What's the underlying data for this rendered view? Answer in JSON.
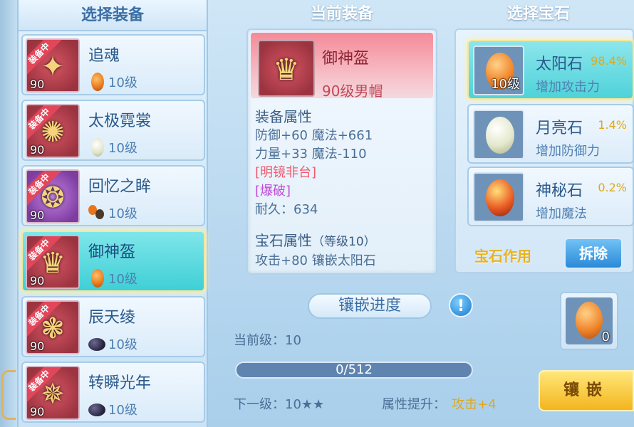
{
  "titles": {
    "select_equipment": "选择装备",
    "current_equipment": "当前装备",
    "select_gem": "选择宝石"
  },
  "equipment_list": [
    {
      "badge": "装备中",
      "level": "90",
      "name": "追魂",
      "gem_type": "orange",
      "gem_level": "10级",
      "glyph": "✦"
    },
    {
      "badge": "装备中",
      "level": "90",
      "name": "太极霓裳",
      "gem_type": "white",
      "gem_level": "10级",
      "glyph": "✺"
    },
    {
      "badge": "装备中",
      "level": "90",
      "name": "回忆之眸",
      "gem_type": "mixed",
      "gem_level": "10级",
      "glyph": "❂"
    },
    {
      "badge": "装备中",
      "level": "90",
      "name": "御神盔",
      "gem_type": "orange",
      "gem_level": "10级",
      "glyph": "♛",
      "selected": true
    },
    {
      "badge": "装备中",
      "level": "90",
      "name": "辰天绫",
      "gem_type": "dark",
      "gem_level": "10级",
      "glyph": "❃"
    },
    {
      "badge": "装备中",
      "level": "90",
      "name": "转瞬光年",
      "gem_type": "dark",
      "gem_level": "10级",
      "glyph": "✵"
    }
  ],
  "current": {
    "name": "御神盔",
    "subtitle": "90级男帽",
    "attr_header": "装备属性",
    "attr_line1": "防御+60 魔法+661",
    "attr_line2": "力量+33 魔法-110",
    "special1": "[明镜非台]",
    "special2": "[爆破]",
    "durability": "耐久：634",
    "gem_attr_header": "宝石属性",
    "gem_attr_level": "（等级10）",
    "gem_attr_line": "攻击+80 镶嵌太阳石"
  },
  "progress": {
    "label": "镶嵌进度",
    "info": "!",
    "current_level": "当前级：10",
    "text": "0/512",
    "value": 0,
    "max": 512,
    "next_level": "下一级：10★★",
    "attr_label": "属性提升：",
    "attr_value": "攻击+4"
  },
  "gems": [
    {
      "name": "太阳石",
      "rate": "98.4%",
      "desc": "增加攻击力",
      "stone": "orange",
      "count": "10级",
      "selected": true
    },
    {
      "name": "月亮石",
      "rate": "1.4%",
      "desc": "增加防御力",
      "stone": "white",
      "count": ""
    },
    {
      "name": "神秘石",
      "rate": "0.2%",
      "desc": "增加魔法",
      "stone": "mystery",
      "count": ""
    }
  ],
  "gem_effect": "宝石作用",
  "remove_btn": "拆除",
  "target_slot": {
    "stone": "orange",
    "count": "0"
  },
  "inlay_btn": "镶嵌"
}
